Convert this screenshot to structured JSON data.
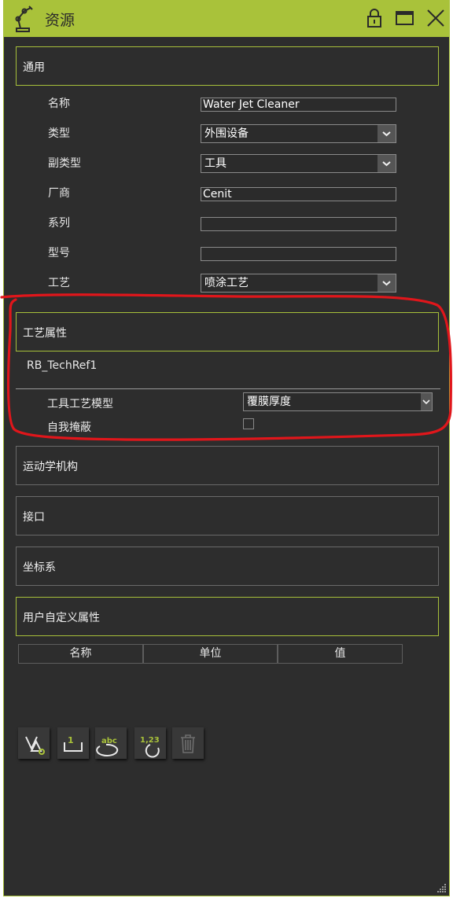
{
  "window": {
    "title": "资源"
  },
  "general": {
    "label": "通用",
    "fields": [
      {
        "label": "名称",
        "value": "Water Jet Cleaner"
      },
      {
        "label": "类型",
        "value": "外围设备"
      },
      {
        "label": "副类型",
        "value": "工具"
      },
      {
        "label": "厂商",
        "value": "Cenit"
      },
      {
        "label": "系列",
        "value": ""
      },
      {
        "label": "型号",
        "value": ""
      },
      {
        "label": "工艺",
        "value": "喷涂工艺"
      }
    ]
  },
  "process_props": {
    "label": "工艺属性",
    "ref_name": "RB_TechRef1",
    "tool_model_label": "工具工艺模型",
    "tool_model_value": "覆膜厚度",
    "self_mask_label": "自我掩蔽",
    "self_mask_checked": false
  },
  "sections": {
    "kinematics": "运动学机构",
    "interface": "接口",
    "frames": "坐标系",
    "user_props": "用户自定义属性"
  },
  "table": {
    "columns": [
      "名称",
      "单位",
      "值"
    ]
  },
  "toolbar": {
    "t2_text": "1",
    "t3_text": "abc",
    "t4_text": "1,23"
  },
  "colors": {
    "accent": "#a9c23a",
    "panel": "#2d2d2d",
    "annotation": "#e0161b"
  },
  "icons": [
    "robot-arm-icon",
    "lock-icon",
    "maximize-icon",
    "close-icon",
    "filter-icon",
    "numbering-icon",
    "rename-text-icon",
    "renumber-icon",
    "trash-icon"
  ]
}
